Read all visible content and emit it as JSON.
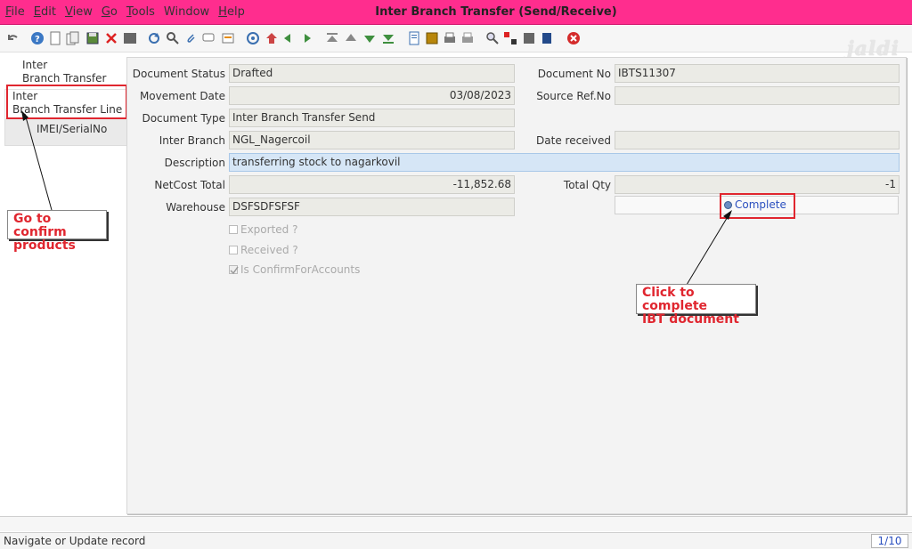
{
  "menu": [
    {
      "key": "F",
      "rest": "ile"
    },
    {
      "key": "E",
      "rest": "dit"
    },
    {
      "key": "V",
      "rest": "iew"
    },
    {
      "key": "G",
      "rest": "o"
    },
    {
      "key": "T",
      "rest": "ools"
    },
    {
      "key": "",
      "rest": "Window"
    },
    {
      "key": "H",
      "rest": "elp"
    }
  ],
  "window_title": "Inter Branch Transfer (Send/Receive)",
  "logo": "jaldi",
  "tabs": {
    "tab1": "Inter\nBranch Transfer",
    "tab2": "Inter\nBranch Transfer Line",
    "tab3": "IMEI/SerialNo"
  },
  "form": {
    "document_status_label": "Document Status",
    "document_status": "Drafted",
    "movement_date_label": "Movement Date",
    "movement_date": "03/08/2023",
    "document_type_label": "Document Type",
    "document_type": "Inter Branch Transfer Send",
    "inter_branch_label": "Inter Branch",
    "inter_branch": "NGL_Nagercoil",
    "description_label": "Description",
    "description": "transferring stock to nagarkovil",
    "netcost_total_label": "NetCost Total",
    "netcost_total": "-11,852.68",
    "warehouse_label": "Warehouse",
    "warehouse": "DSFSDFSFSF",
    "exported_label": "Exported ?",
    "received_label": "Received ?",
    "confirm_accounts_label": "Is ConfirmForAccounts",
    "document_no_label": "Document No",
    "document_no": "IBTS11307",
    "source_ref_label": "Source Ref.No",
    "source_ref": "",
    "date_received_label": "Date received",
    "date_received": "",
    "total_qty_label": "Total Qty",
    "total_qty": "-1",
    "complete_label": "Complete"
  },
  "callouts": {
    "confirm_products": "Go to confirm\nproducts",
    "complete_ibt": "Click to complete\nIBT document"
  },
  "status": {
    "message": "Navigate or Update record",
    "record": "1/10"
  },
  "colors": {
    "titlebar": "#ff2d8e",
    "callout_text": "#e0262f",
    "active_field": "#d6e6f6"
  }
}
